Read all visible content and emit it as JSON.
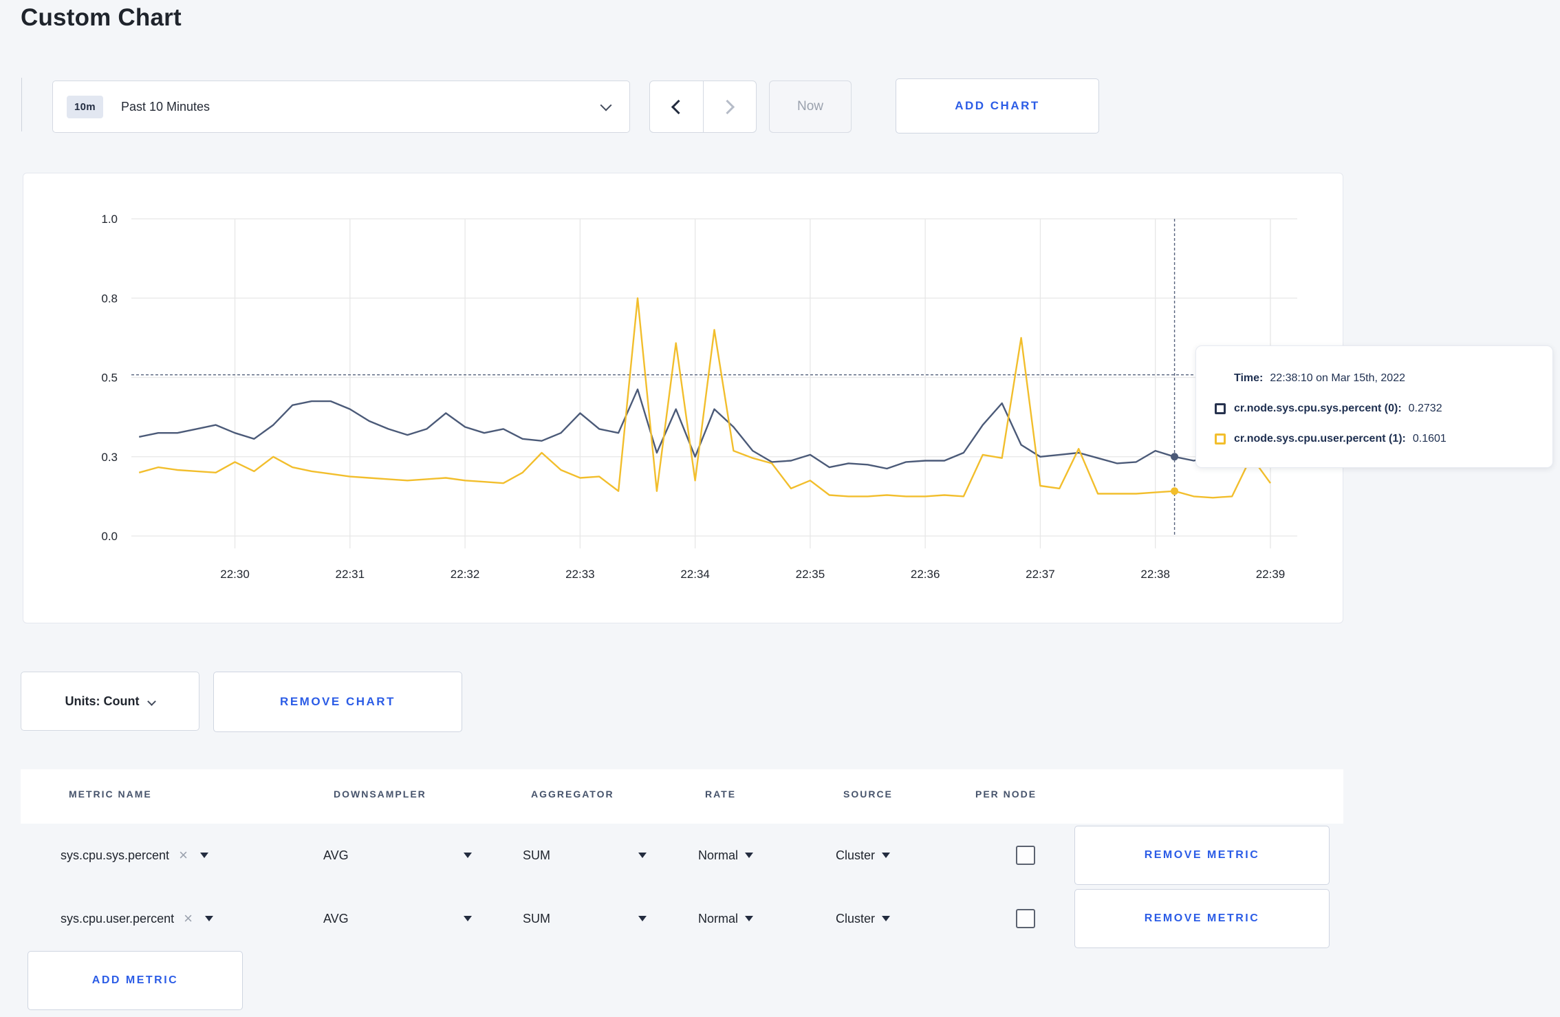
{
  "page": {
    "title": "Custom Chart"
  },
  "toolbar": {
    "time_window_badge": "10m",
    "time_window_label": "Past 10 Minutes",
    "prev_label": "previous time window",
    "next_label": "next time window",
    "now_label": "Now",
    "add_chart_label": "ADD CHART"
  },
  "chart_data": {
    "type": "line",
    "title": "",
    "xlabel": "",
    "ylabel": "",
    "grid": true,
    "legend_position": "tooltip",
    "y_axis": {
      "ticks": [
        1.0,
        0.8,
        0.5,
        0.3,
        0.0
      ],
      "tick_labels": [
        "1.0",
        "0.8",
        "0.5",
        "0.3",
        "0.0"
      ],
      "range": [
        0.0,
        1.0
      ]
    },
    "x_axis": {
      "tick_labels": [
        "22:30",
        "22:31",
        "22:32",
        "22:33",
        "22:34",
        "22:35",
        "22:36",
        "22:37",
        "22:38",
        "22:39"
      ],
      "domain_start": "22:29:06",
      "domain_end": "22:39:14"
    },
    "series_start_time": "22:29:10",
    "sample_interval_seconds": 10,
    "series": [
      {
        "name": "cr.node.sys.cpu.sys.percent",
        "color": "#4b5a78",
        "values": [
          0.35,
          0.36,
          0.36,
          0.37,
          0.38,
          0.36,
          0.345,
          0.38,
          0.43,
          0.44,
          0.44,
          0.42,
          0.39,
          0.37,
          0.355,
          0.37,
          0.41,
          0.375,
          0.36,
          0.37,
          0.345,
          0.34,
          0.36,
          0.41,
          0.37,
          0.36,
          0.47,
          0.31,
          0.42,
          0.3,
          0.42,
          0.375,
          0.315,
          0.28,
          0.285,
          0.305,
          0.26,
          0.275,
          0.27,
          0.255,
          0.28,
          0.285,
          0.285,
          0.31,
          0.38,
          0.435,
          0.33,
          0.3,
          0.305,
          0.31,
          0.295,
          0.275,
          0.28,
          0.315,
          0.3,
          0.285,
          0.3,
          0.31,
          0.3,
          0.295
        ]
      },
      {
        "name": "cr.node.sys.cpu.user.percent",
        "color": "#f2be2c",
        "values": [
          0.24,
          0.26,
          0.25,
          0.245,
          0.24,
          0.28,
          0.245,
          0.3,
          0.26,
          0.245,
          0.235,
          0.225,
          0.22,
          0.215,
          0.21,
          0.215,
          0.22,
          0.21,
          0.205,
          0.2,
          0.24,
          0.31,
          0.25,
          0.22,
          0.225,
          0.17,
          0.8,
          0.17,
          0.63,
          0.21,
          0.68,
          0.315,
          0.295,
          0.275,
          0.18,
          0.21,
          0.155,
          0.15,
          0.15,
          0.155,
          0.15,
          0.15,
          0.155,
          0.15,
          0.305,
          0.295,
          0.65,
          0.19,
          0.18,
          0.32,
          0.16,
          0.16,
          0.16,
          0.165,
          0.17,
          0.15,
          0.145,
          0.15,
          0.3,
          0.2
        ]
      }
    ],
    "crosshair": {
      "time": "22:38:10",
      "hover_value": 0.51
    }
  },
  "tooltip": {
    "time_label": "Time:",
    "time_value": "22:38:10 on Mar 15th, 2022",
    "series": [
      {
        "label": "cr.node.sys.cpu.sys.percent (0):",
        "value": "0.2732",
        "color": "#26324e"
      },
      {
        "label": "cr.node.sys.cpu.user.percent (1):",
        "value": "0.1601",
        "color": "#f2be2c"
      }
    ]
  },
  "chart_footer": {
    "units_label": "Units: Count",
    "remove_chart_label": "REMOVE CHART"
  },
  "metrics_table": {
    "headers": [
      "METRIC NAME",
      "DOWNSAMPLER",
      "AGGREGATOR",
      "RATE",
      "SOURCE",
      "PER NODE"
    ],
    "rows": [
      {
        "metric": "sys.cpu.sys.percent",
        "downsampler": "AVG",
        "aggregator": "SUM",
        "rate": "Normal",
        "source": "Cluster",
        "per_node_checked": false,
        "remove_label": "REMOVE METRIC"
      },
      {
        "metric": "sys.cpu.user.percent",
        "downsampler": "AVG",
        "aggregator": "SUM",
        "rate": "Normal",
        "source": "Cluster",
        "per_node_checked": false,
        "remove_label": "REMOVE METRIC"
      }
    ],
    "add_metric_label": "ADD METRIC"
  },
  "colors": {
    "accent_blue": "#2b5ce6",
    "series_sys": "#4b5a78",
    "series_user": "#f2be2c",
    "page_background": "#f4f6f9",
    "gridline": "#e7e7e7",
    "crosshair": "#55617c"
  }
}
